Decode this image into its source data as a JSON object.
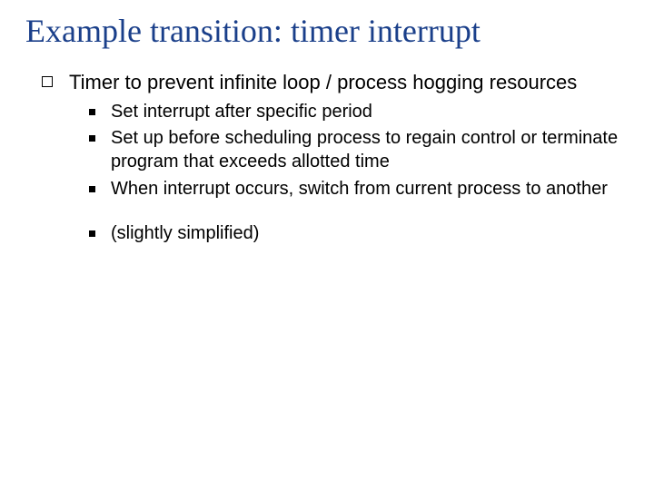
{
  "title": "Example transition: timer interrupt",
  "bullets": {
    "main": "Timer to prevent infinite loop / process hogging resources",
    "sub1": "Set interrupt after specific period",
    "sub2": "Set up before scheduling process to regain control or terminate program that exceeds allotted time",
    "sub3": "When interrupt occurs, switch from current process to another",
    "sub4": "(slightly simplified)"
  }
}
